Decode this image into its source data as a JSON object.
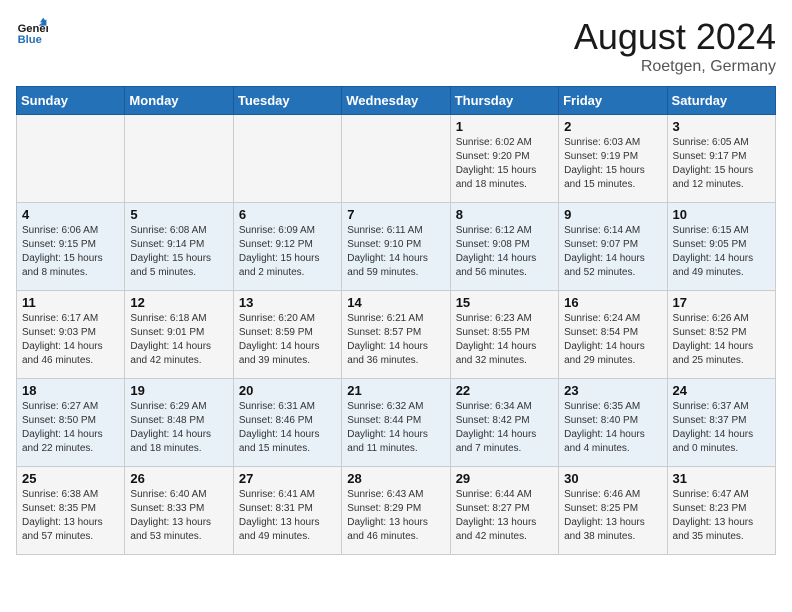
{
  "logo": {
    "line1": "General",
    "line2": "Blue"
  },
  "title": "August 2024",
  "subtitle": "Roetgen, Germany",
  "weekdays": [
    "Sunday",
    "Monday",
    "Tuesday",
    "Wednesday",
    "Thursday",
    "Friday",
    "Saturday"
  ],
  "weeks": [
    [
      {
        "day": "",
        "info": ""
      },
      {
        "day": "",
        "info": ""
      },
      {
        "day": "",
        "info": ""
      },
      {
        "day": "",
        "info": ""
      },
      {
        "day": "1",
        "info": "Sunrise: 6:02 AM\nSunset: 9:20 PM\nDaylight: 15 hours\nand 18 minutes."
      },
      {
        "day": "2",
        "info": "Sunrise: 6:03 AM\nSunset: 9:19 PM\nDaylight: 15 hours\nand 15 minutes."
      },
      {
        "day": "3",
        "info": "Sunrise: 6:05 AM\nSunset: 9:17 PM\nDaylight: 15 hours\nand 12 minutes."
      }
    ],
    [
      {
        "day": "4",
        "info": "Sunrise: 6:06 AM\nSunset: 9:15 PM\nDaylight: 15 hours\nand 8 minutes."
      },
      {
        "day": "5",
        "info": "Sunrise: 6:08 AM\nSunset: 9:14 PM\nDaylight: 15 hours\nand 5 minutes."
      },
      {
        "day": "6",
        "info": "Sunrise: 6:09 AM\nSunset: 9:12 PM\nDaylight: 15 hours\nand 2 minutes."
      },
      {
        "day": "7",
        "info": "Sunrise: 6:11 AM\nSunset: 9:10 PM\nDaylight: 14 hours\nand 59 minutes."
      },
      {
        "day": "8",
        "info": "Sunrise: 6:12 AM\nSunset: 9:08 PM\nDaylight: 14 hours\nand 56 minutes."
      },
      {
        "day": "9",
        "info": "Sunrise: 6:14 AM\nSunset: 9:07 PM\nDaylight: 14 hours\nand 52 minutes."
      },
      {
        "day": "10",
        "info": "Sunrise: 6:15 AM\nSunset: 9:05 PM\nDaylight: 14 hours\nand 49 minutes."
      }
    ],
    [
      {
        "day": "11",
        "info": "Sunrise: 6:17 AM\nSunset: 9:03 PM\nDaylight: 14 hours\nand 46 minutes."
      },
      {
        "day": "12",
        "info": "Sunrise: 6:18 AM\nSunset: 9:01 PM\nDaylight: 14 hours\nand 42 minutes."
      },
      {
        "day": "13",
        "info": "Sunrise: 6:20 AM\nSunset: 8:59 PM\nDaylight: 14 hours\nand 39 minutes."
      },
      {
        "day": "14",
        "info": "Sunrise: 6:21 AM\nSunset: 8:57 PM\nDaylight: 14 hours\nand 36 minutes."
      },
      {
        "day": "15",
        "info": "Sunrise: 6:23 AM\nSunset: 8:55 PM\nDaylight: 14 hours\nand 32 minutes."
      },
      {
        "day": "16",
        "info": "Sunrise: 6:24 AM\nSunset: 8:54 PM\nDaylight: 14 hours\nand 29 minutes."
      },
      {
        "day": "17",
        "info": "Sunrise: 6:26 AM\nSunset: 8:52 PM\nDaylight: 14 hours\nand 25 minutes."
      }
    ],
    [
      {
        "day": "18",
        "info": "Sunrise: 6:27 AM\nSunset: 8:50 PM\nDaylight: 14 hours\nand 22 minutes."
      },
      {
        "day": "19",
        "info": "Sunrise: 6:29 AM\nSunset: 8:48 PM\nDaylight: 14 hours\nand 18 minutes."
      },
      {
        "day": "20",
        "info": "Sunrise: 6:31 AM\nSunset: 8:46 PM\nDaylight: 14 hours\nand 15 minutes."
      },
      {
        "day": "21",
        "info": "Sunrise: 6:32 AM\nSunset: 8:44 PM\nDaylight: 14 hours\nand 11 minutes."
      },
      {
        "day": "22",
        "info": "Sunrise: 6:34 AM\nSunset: 8:42 PM\nDaylight: 14 hours\nand 7 minutes."
      },
      {
        "day": "23",
        "info": "Sunrise: 6:35 AM\nSunset: 8:40 PM\nDaylight: 14 hours\nand 4 minutes."
      },
      {
        "day": "24",
        "info": "Sunrise: 6:37 AM\nSunset: 8:37 PM\nDaylight: 14 hours\nand 0 minutes."
      }
    ],
    [
      {
        "day": "25",
        "info": "Sunrise: 6:38 AM\nSunset: 8:35 PM\nDaylight: 13 hours\nand 57 minutes."
      },
      {
        "day": "26",
        "info": "Sunrise: 6:40 AM\nSunset: 8:33 PM\nDaylight: 13 hours\nand 53 minutes."
      },
      {
        "day": "27",
        "info": "Sunrise: 6:41 AM\nSunset: 8:31 PM\nDaylight: 13 hours\nand 49 minutes."
      },
      {
        "day": "28",
        "info": "Sunrise: 6:43 AM\nSunset: 8:29 PM\nDaylight: 13 hours\nand 46 minutes."
      },
      {
        "day": "29",
        "info": "Sunrise: 6:44 AM\nSunset: 8:27 PM\nDaylight: 13 hours\nand 42 minutes."
      },
      {
        "day": "30",
        "info": "Sunrise: 6:46 AM\nSunset: 8:25 PM\nDaylight: 13 hours\nand 38 minutes."
      },
      {
        "day": "31",
        "info": "Sunrise: 6:47 AM\nSunset: 8:23 PM\nDaylight: 13 hours\nand 35 minutes."
      }
    ]
  ]
}
